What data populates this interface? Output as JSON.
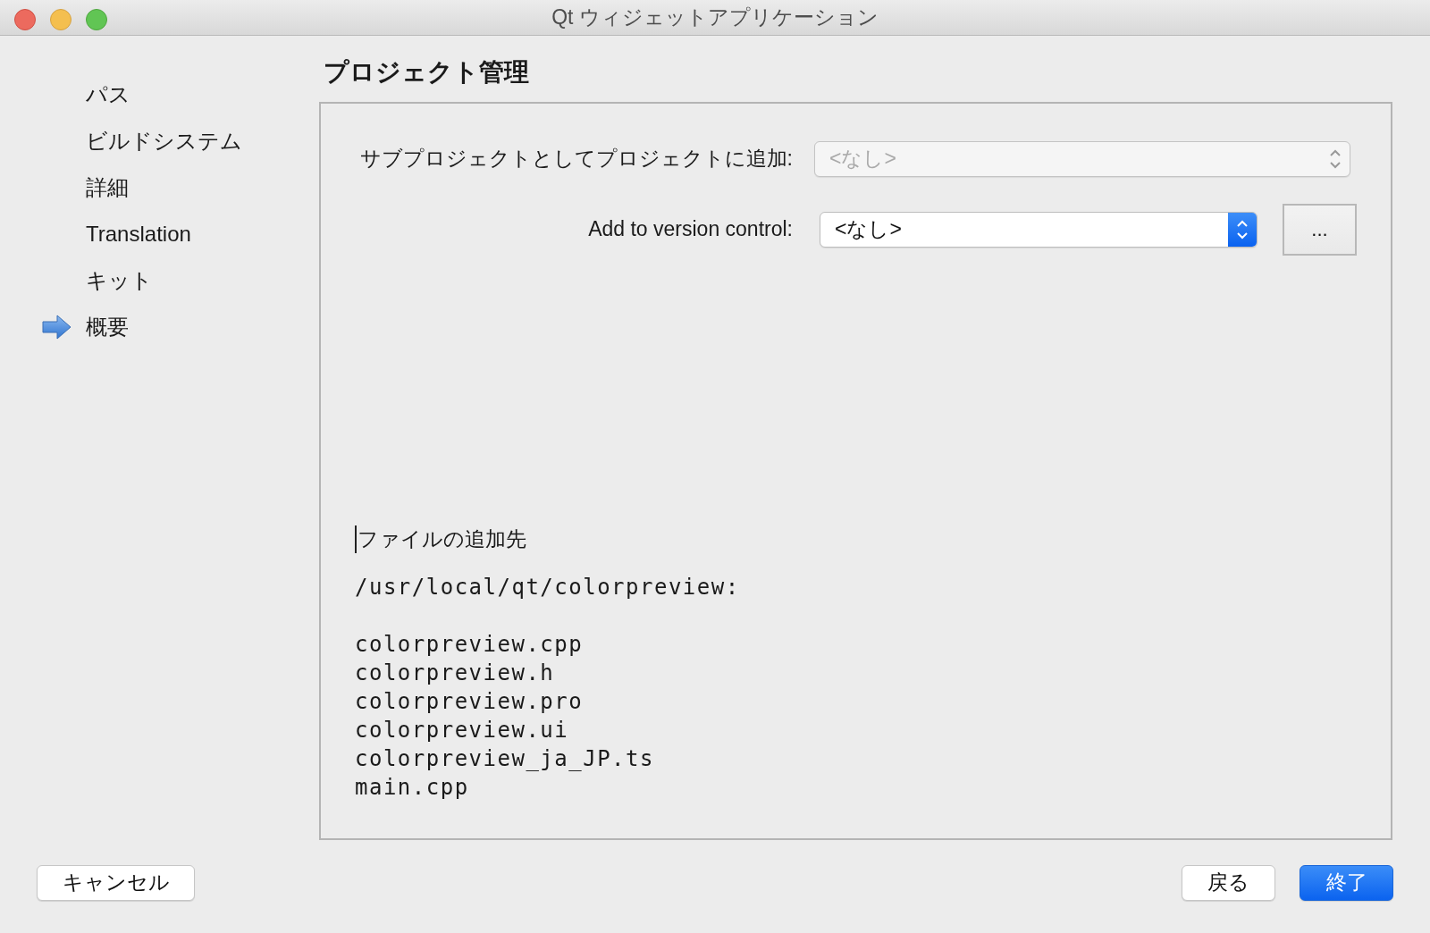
{
  "window": {
    "title": "Qt ウィジェットアプリケーション"
  },
  "sidebar": {
    "items": [
      {
        "label": "パス",
        "selected": false
      },
      {
        "label": "ビルドシステム",
        "selected": false
      },
      {
        "label": "詳細",
        "selected": false
      },
      {
        "label": "Translation",
        "selected": false
      },
      {
        "label": "キット",
        "selected": false
      },
      {
        "label": "概要",
        "selected": true
      }
    ]
  },
  "page": {
    "heading": "プロジェクト管理",
    "fields": [
      {
        "label": "サブプロジェクトとしてプロジェクトに追加:",
        "value": "<なし>",
        "disabled": true,
        "has_browse": false
      },
      {
        "label": "Add to version control:",
        "value": "<なし>",
        "disabled": false,
        "has_browse": true,
        "browse_label": "..."
      }
    ],
    "summary": {
      "heading": "ファイルの追加先",
      "path": "/usr/local/qt/colorpreview:",
      "files": [
        "colorpreview.cpp",
        "colorpreview.h",
        "colorpreview.pro",
        "colorpreview.ui",
        "colorpreview_ja_JP.ts",
        "main.cpp"
      ]
    }
  },
  "buttons": [
    {
      "label": "キャンセル",
      "kind": "plain"
    },
    {
      "label": "戻る",
      "kind": "plain"
    },
    {
      "label": "終了",
      "kind": "default"
    }
  ]
}
